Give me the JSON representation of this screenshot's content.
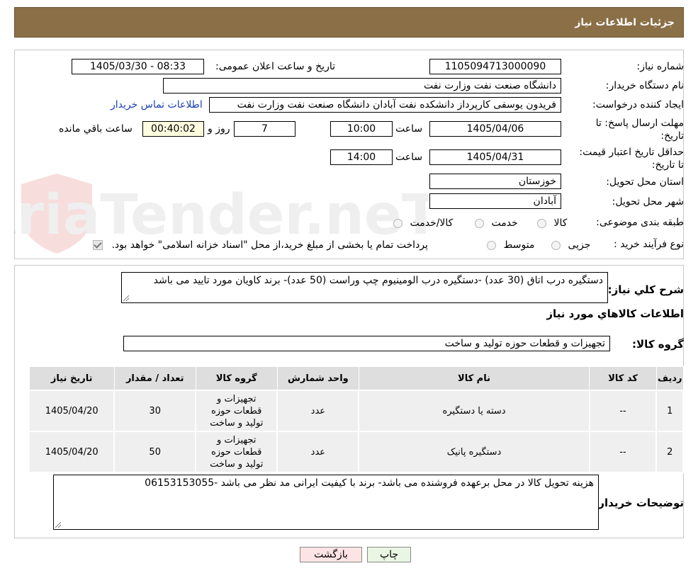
{
  "header": {
    "title": "جزئیات اطلاعات نیاز"
  },
  "watermark": {
    "text": "AriaTender.neT"
  },
  "fields": {
    "need_number_label": "شماره نیاز:",
    "need_number": "1105094713000090",
    "announce_label": "تاریخ و ساعت اعلان عمومی:",
    "announce_value": "1405/03/30 - 08:33",
    "buyer_org_label": "نام دستگاه خریدار:",
    "buyer_org": "دانشگاه صنعت نفت وزارت نفت",
    "requester_label": "ایجاد کننده درخواست:",
    "requester": "فریدون یوسفی کارپرداز دانشکده نفت آبادان دانشگاه صنعت نفت وزارت نفت",
    "contact_link": "اطلاعات تماس خریدار",
    "deadline_label": "مهلت ارسال پاسخ: تا تاریخ:",
    "deadline_date": "1405/04/06",
    "time_label": "ساعت",
    "deadline_time": "10:00",
    "days": "7",
    "days_label": "روز و",
    "remaining_time": "00:40:02",
    "remaining_label": "ساعت باقي مانده",
    "validity_label": "حداقل تاریخ اعتبار قیمت: تا تاریخ:",
    "validity_date": "1405/04/31",
    "validity_time": "14:00",
    "province_label": "استان محل تحویل:",
    "province": "خوزستان",
    "city_label": "شهر محل تحویل:",
    "city": "آبادان",
    "category_label": "طبقه بندی موضوعی:",
    "category_options": [
      "کالا",
      "خدمت",
      "کالا/خدمت"
    ],
    "process_label": "نوع فرآیند خرید :",
    "process_options": [
      "جزیی",
      "متوسط"
    ],
    "payment_note": "پرداخت تمام یا بخشی از مبلغ خرید،از محل \"اسناد خزانه اسلامی\" خواهد بود."
  },
  "description": {
    "label": "شرح کلي نياز:",
    "text": "دستگیره درب اتاق  (30 عدد) -دستگیره درب الومینیوم چپ وراست (50 عدد)- برند  کاویان  مورد تایید می باشد"
  },
  "goods": {
    "section_title": "اطلاعات کالاهاي مورد نياز",
    "group_label": "گروه کالا:",
    "group_value": "تجهیزات و قطعات حوزه تولید و ساخت"
  },
  "table": {
    "headers": [
      "رديف",
      "کد کالا",
      "نام کالا",
      "واحد شمارش",
      "گروه کالا",
      "تعداد / مقدار",
      "تاريخ نياز"
    ],
    "rows": [
      {
        "row": "1",
        "code": "--",
        "name": "دسته یا دستگیره",
        "unit": "عدد",
        "group": "تجهیزات و قطعات حوزه تولید و ساخت",
        "qty": "30",
        "date": "1405/04/20"
      },
      {
        "row": "2",
        "code": "--",
        "name": "دستگیره پانیک",
        "unit": "عدد",
        "group": "تجهیزات و قطعات حوزه تولید و ساخت",
        "qty": "50",
        "date": "1405/04/20"
      }
    ]
  },
  "buyer_notes": {
    "label": "توضیحات خریدار:",
    "text": "هزینه تحویل کالا در محل برعهده فروشنده می باشد- برند با کیفیت ایرانی مد نظر می باشد -06153153055"
  },
  "buttons": {
    "print": "چاپ",
    "back": "بازگشت"
  },
  "colors": {
    "header_bg": "#8b6f47",
    "back_btn_bg": "#fde4e4",
    "print_btn_bg": "#eaf6e4",
    "remaining_bg": "#ffffe0"
  }
}
